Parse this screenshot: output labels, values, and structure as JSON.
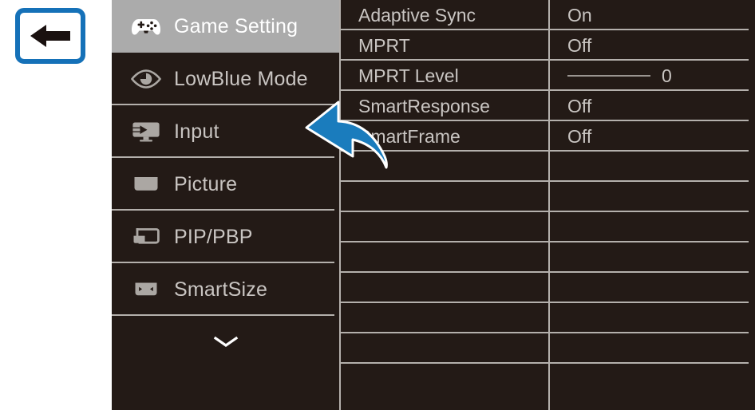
{
  "callout": {
    "back_button": {
      "icon": "left-arrow-icon",
      "border_color": "#1571B8",
      "arrow_color": "#1A1110",
      "background": "#FFFFFF"
    }
  },
  "annotation": {
    "arrow": {
      "icon": "curved-arrow-up-left-icon",
      "color": "#1A7CBD",
      "outline_color": "#FFFFFF"
    }
  },
  "osd": {
    "background_color": "#231A16",
    "highlight_color": "#ABABAB",
    "divider_color": "#B4B0AC",
    "text_color": "#C9C5C2",
    "selected_text_color": "#FFFFFF",
    "sidebar": {
      "items": [
        {
          "label": "Game Setting",
          "icon": "gamepad-icon",
          "selected": true
        },
        {
          "label": "LowBlue Mode",
          "icon": "eye-icon",
          "selected": false
        },
        {
          "label": "Input",
          "icon": "monitor-input-icon",
          "selected": false
        },
        {
          "label": "Picture",
          "icon": "monitor-filled-icon",
          "selected": false
        },
        {
          "label": "PIP/PBP",
          "icon": "pip-pbp-icon",
          "selected": false
        },
        {
          "label": "SmartSize",
          "icon": "smartsize-icon",
          "selected": false
        }
      ],
      "more_indicator": {
        "icon": "chevron-down-icon"
      }
    },
    "settings": {
      "rows": [
        {
          "name": "Adaptive Sync",
          "value": "On",
          "type": "text"
        },
        {
          "name": "MPRT",
          "value": "Off",
          "type": "text"
        },
        {
          "name": "MPRT Level",
          "value": "0",
          "type": "slider"
        },
        {
          "name": "SmartResponse",
          "value": "Off",
          "type": "text"
        },
        {
          "name": "SmartFrame",
          "value": "Off",
          "type": "text"
        },
        {
          "name": "",
          "value": "",
          "type": "empty"
        },
        {
          "name": "",
          "value": "",
          "type": "empty"
        },
        {
          "name": "",
          "value": "",
          "type": "empty"
        },
        {
          "name": "",
          "value": "",
          "type": "empty"
        },
        {
          "name": "",
          "value": "",
          "type": "empty"
        },
        {
          "name": "",
          "value": "",
          "type": "empty"
        },
        {
          "name": "",
          "value": "",
          "type": "empty"
        },
        {
          "name": "",
          "value": "",
          "type": "empty"
        }
      ]
    }
  }
}
